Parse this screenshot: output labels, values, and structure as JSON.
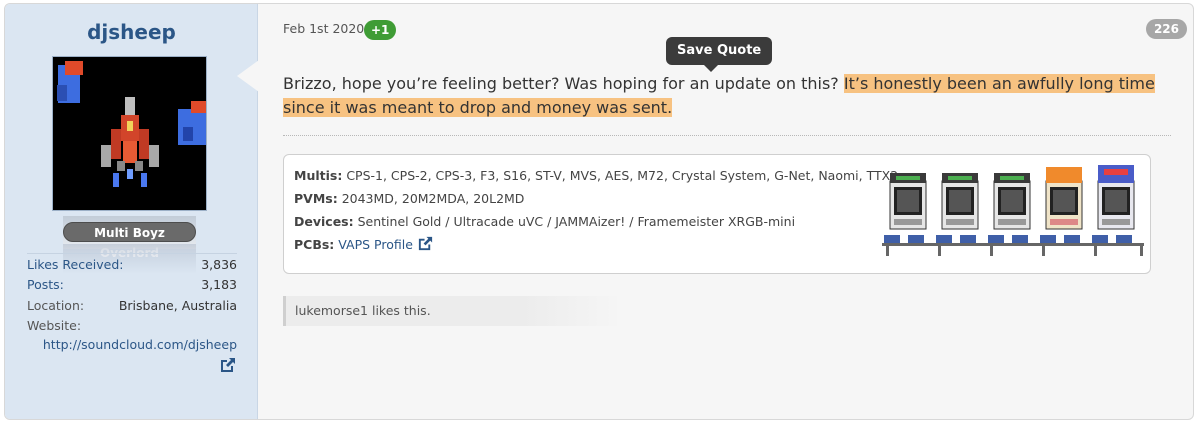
{
  "user": {
    "username": "djsheep",
    "title": "Multi Boyz Overlord",
    "stats": [
      {
        "label": "Likes Received:",
        "value": "3,836"
      },
      {
        "label": "Posts:",
        "value": "3,183"
      },
      {
        "label": "Location:",
        "value": "Brisbane, Australia"
      }
    ],
    "website_label": "Website:",
    "website_url": "http://soundcloud.com/djsheep"
  },
  "post": {
    "date": "Feb 1st 2020",
    "reaction_badge": "+1",
    "post_number": "226",
    "tooltip": "Save Quote",
    "message_plain": "Brizzo, hope you’re feeling better? Was hoping for an update on this? ",
    "message_highlight": "It’s honestly been an awfully long time since it was meant to drop and money was sent."
  },
  "signature": {
    "multis_label": "Multis:",
    "multis": "CPS-1, CPS-2, CPS-3, F3, S16, ST-V, MVS, AES, M72, Crystal System, G-Net, Naomi, TTX2",
    "pvms_label": "PVMs:",
    "pvms": "2043MD, 20M2MDA, 20L2MD",
    "devices_label": "Devices:",
    "devices": "Sentinel Gold / Ultracade uVC / JAMMAizer! / Framemeister XRGB-mini",
    "pcbs_label": "PCBs:",
    "pcbs_link": "VAPS Profile"
  },
  "likes": {
    "text": "lukemorse1 likes this."
  },
  "icons": {
    "external_link": "external-link-icon",
    "avatar": "spaceship-avatar",
    "cabinets": "arcade-cabinets-image"
  },
  "colors": {
    "accent": "#2b5687",
    "highlight": "#f7c281",
    "reaction_green": "#3f9c35"
  }
}
